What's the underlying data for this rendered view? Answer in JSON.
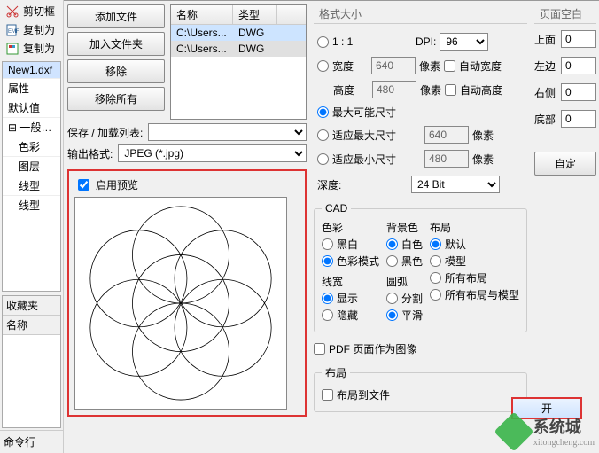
{
  "sidebar": {
    "tools": [
      {
        "icon": "cut",
        "label": "剪切框"
      },
      {
        "icon": "copy",
        "label": "复制为"
      },
      {
        "icon": "copy2",
        "label": "复制为"
      }
    ],
    "tree": {
      "root": "New1.dxf",
      "props": "属性",
      "defaults": "默认值",
      "general": "一般设置",
      "children": [
        "色彩",
        "图层",
        "线型",
        "线型"
      ]
    },
    "favorites_title": "收藏夹",
    "fav_col": "名称",
    "cmdline": "命令行"
  },
  "filepanel": {
    "add_file": "添加文件",
    "add_folder": "加入文件夹",
    "remove": "移除",
    "remove_all": "移除所有",
    "list_header": {
      "name": "名称",
      "type": "类型"
    },
    "rows": [
      {
        "name": "C:\\Users...",
        "type": "DWG"
      },
      {
        "name": "C:\\Users...",
        "type": "DWG"
      }
    ],
    "save_list_label": "保存 / 加载列表:",
    "output_format_label": "输出格式:",
    "output_format_value": "JPEG (*.jpg)",
    "enable_preview": "启用预览"
  },
  "options": {
    "size_group": "格式大小",
    "ratio_11": "1 : 1",
    "dpi_label": "DPI:",
    "dpi_value": "96",
    "width_label": "宽度",
    "width_value": "640",
    "px": "像素",
    "auto_width": "自动宽度",
    "height_label": "高度",
    "height_value": "480",
    "auto_height": "自动高度",
    "max_possible": "最大可能尺寸",
    "fit_max": "适应最大尺寸",
    "fit_max_val": "640",
    "fit_min": "适应最小尺寸",
    "fit_min_val": "480",
    "depth_label": "深度:",
    "depth_value": "24 Bit",
    "cad_title": "CAD",
    "color_title": "色彩",
    "color_bw": "黑白",
    "color_mode": "色彩模式",
    "bg_title": "背景色",
    "bg_white": "白色",
    "bg_black": "黑色",
    "layout_title": "布局",
    "layout_default": "默认",
    "layout_model": "模型",
    "layout_all": "所有布局",
    "layout_allmodel": "所有布局与模型",
    "lw_title": "线宽",
    "lw_show": "显示",
    "lw_hide": "隐藏",
    "arc_title": "圆弧",
    "arc_split": "分割",
    "arc_smooth": "平滑",
    "pdf_as_image": "PDF 页面作为图像",
    "layout_group": "布局",
    "layout_to_file": "布局到文件"
  },
  "margins": {
    "title": "页面空白",
    "top": "上面",
    "top_v": "0",
    "left": "左边",
    "left_v": "0",
    "right": "右侧",
    "right_v": "0",
    "bottom": "底部",
    "bottom_v": "0",
    "custom": "自定"
  },
  "open_button": "开",
  "watermark": {
    "t1": "系统城",
    "t2": "xitongcheng.com"
  }
}
